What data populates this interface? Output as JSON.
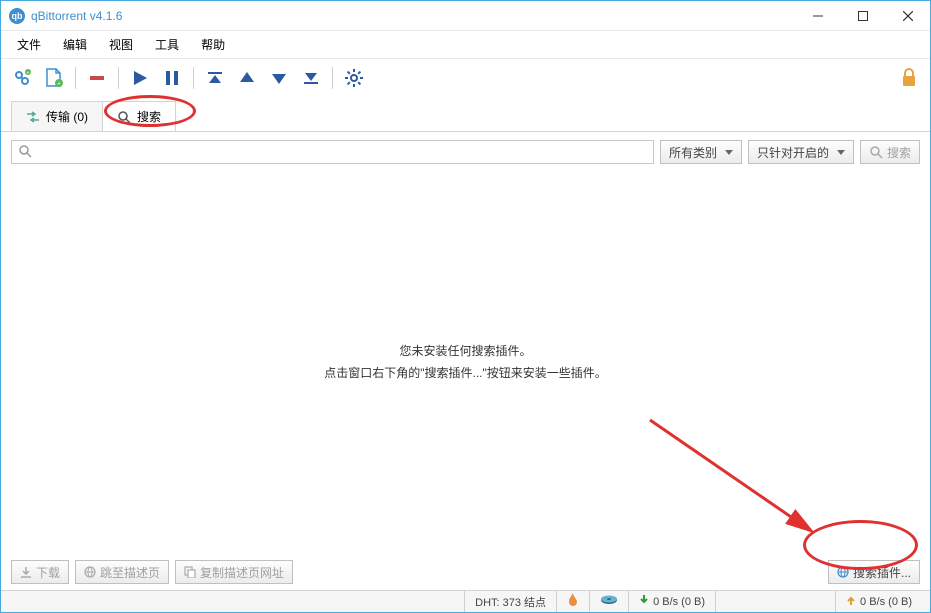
{
  "titlebar": {
    "title": "qBittorrent v4.1.6"
  },
  "menubar": {
    "items": [
      "文件",
      "编辑",
      "视图",
      "工具",
      "帮助"
    ]
  },
  "tabs": {
    "transfers": {
      "label": "传输 (0)"
    },
    "search": {
      "label": "搜索"
    }
  },
  "searchbar": {
    "placeholder": "",
    "category": "所有类别",
    "scope": "只针对开启的",
    "search_btn": "搜索"
  },
  "content": {
    "line1": "您未安装任何搜索插件。",
    "line2": "点击窗口右下角的\"搜索插件...\"按钮来安装一些插件。"
  },
  "bottom": {
    "download": "下载",
    "goto_desc": "跳至描述页",
    "copy_desc": "复制描述页网址",
    "plugins": "搜索插件..."
  },
  "status": {
    "dht": "DHT: 373 结点",
    "down": "0 B/s (0 B)",
    "up": "0 B/s (0 B)"
  }
}
